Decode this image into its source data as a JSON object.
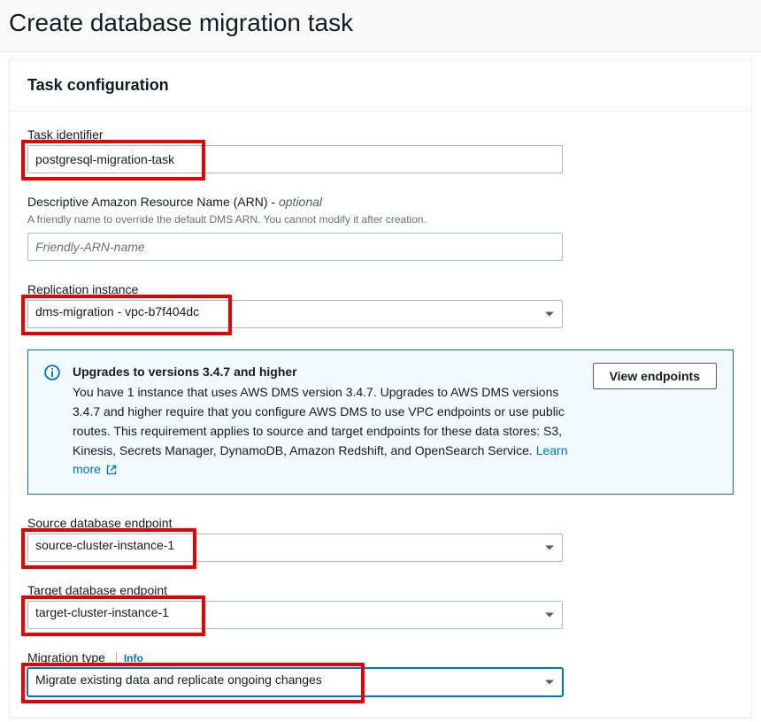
{
  "page": {
    "title": "Create database migration task"
  },
  "panel": {
    "title": "Task configuration"
  },
  "fields": {
    "taskIdentifier": {
      "label": "Task identifier",
      "value": "postgresql-migration-task"
    },
    "arn": {
      "label": "Descriptive Amazon Resource Name (ARN) - ",
      "optional": "optional",
      "hint": "A friendly name to override the default DMS ARN. You cannot modify it after creation.",
      "placeholder": "Friendly-ARN-name"
    },
    "replicationInstance": {
      "label": "Replication instance",
      "value": "dms-migration - vpc-b7f404dc"
    },
    "sourceEndpoint": {
      "label": "Source database endpoint",
      "value": "source-cluster-instance-1"
    },
    "targetEndpoint": {
      "label": "Target database endpoint",
      "value": "target-cluster-instance-1"
    },
    "migrationType": {
      "label": "Migration type",
      "info": "Info",
      "value": "Migrate existing data and replicate ongoing changes"
    }
  },
  "alert": {
    "title": "Upgrades to versions 3.4.7 and higher",
    "body": "You have 1 instance that uses AWS DMS version 3.4.7. Upgrades to AWS DMS versions 3.4.7 and higher require that you configure AWS DMS to use VPC endpoints or use public routes. This requirement applies to source and target endpoints for these data stores: S3, Kinesis, Secrets Manager, DynamoDB, Amazon Redshift, and OpenSearch Service. ",
    "learnMore": "Learn more",
    "button": "View endpoints"
  }
}
